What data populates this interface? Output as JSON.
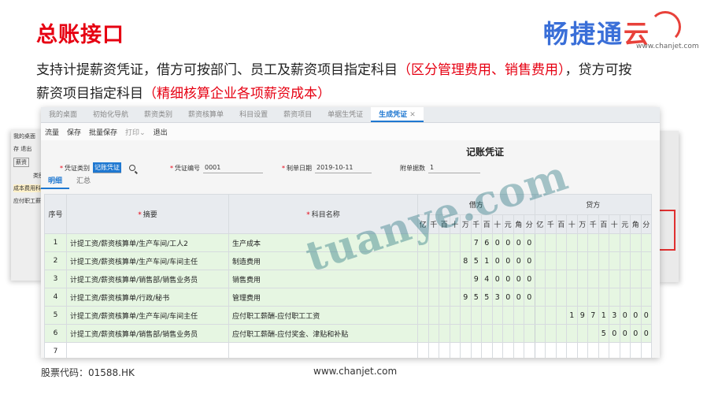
{
  "title": "总账接口",
  "logo": {
    "text_main": "畅捷通",
    "text_suffix": "云",
    "url": "www.chanjet.com",
    "colors": {
      "blue": "#3a6fd8",
      "red": "#e8413a"
    }
  },
  "description": {
    "line1_a": "支持计提薪资凭证，借方可按部门、员工及薪资项目指定科目",
    "line1_red": "（区分管理费用、销售费用）",
    "line1_b": "，贷方可按",
    "line2_a": "薪资项目指定科目",
    "line2_red": "（精细核算企业各项薪资成本）"
  },
  "app": {
    "tabs": [
      "我的桌面",
      "初始化导航",
      "薪资类别",
      "薪资核算单",
      "科目设置",
      "薪资项目",
      "单据生凭证",
      "生成凭证"
    ],
    "active_tab": "生成凭证",
    "close_icon": "✕",
    "toolbar": {
      "flow": "流量",
      "save": "保存",
      "batch_save": "批量保存",
      "print": "打印",
      "print_caret": "⌄",
      "exit": "退出"
    },
    "voucher_title": "记账凭证",
    "form": {
      "category_label": "凭证类别",
      "category_value": "记账凭证",
      "number_label": "凭证编号",
      "number_value": "0001",
      "date_label": "制单日期",
      "date_value": "2019-10-11",
      "attach_label": "附单据数",
      "attach_value": "1",
      "required_mark": "*"
    },
    "subtabs": [
      "明细",
      "汇总"
    ],
    "grid": {
      "col_seq": "序号",
      "col_summary": "摘要",
      "col_account": "科目名称",
      "debit": "借方",
      "credit": "贷方",
      "units": [
        "亿",
        "千",
        "百",
        "十",
        "万",
        "千",
        "百",
        "十",
        "元",
        "角",
        "分"
      ],
      "rows": [
        {
          "seq": "1",
          "summary": "计提工资/薪资核算单/生产车间/工人2",
          "account": "生产成本",
          "debit": [
            "",
            "",
            "",
            "",
            "",
            "",
            "7",
            "6",
            "0",
            "0",
            "0",
            "0"
          ],
          "credit": [
            "",
            "",
            "",
            "",
            "",
            "",
            "",
            "",
            "",
            "",
            ""
          ]
        },
        {
          "seq": "2",
          "summary": "计提工资/薪资核算单/生产车间/车间主任",
          "account": "制造费用",
          "debit": [
            "",
            "",
            "",
            "",
            "",
            "8",
            "5",
            "1",
            "0",
            "0",
            "0",
            "0"
          ],
          "credit": [
            "",
            "",
            "",
            "",
            "",
            "",
            "",
            "",
            "",
            "",
            ""
          ]
        },
        {
          "seq": "3",
          "summary": "计提工资/薪资核算单/销售部/销售业务员",
          "account": "销售费用",
          "debit": [
            "",
            "",
            "",
            "",
            "",
            "",
            "9",
            "4",
            "0",
            "0",
            "0",
            "0"
          ],
          "credit": [
            "",
            "",
            "",
            "",
            "",
            "",
            "",
            "",
            "",
            "",
            ""
          ]
        },
        {
          "seq": "4",
          "summary": "计提工资/薪资核算单/行政/秘书",
          "account": "管理费用",
          "debit": [
            "",
            "",
            "",
            "",
            "",
            "9",
            "5",
            "5",
            "3",
            "0",
            "0",
            "0"
          ],
          "credit": [
            "",
            "",
            "",
            "",
            "",
            "",
            "",
            "",
            "",
            "",
            ""
          ]
        },
        {
          "seq": "5",
          "summary": "计提工资/薪资核算单/生产车间/车间主任",
          "account": "应付职工薪酬-应付职工工资",
          "debit": [
            "",
            "",
            "",
            "",
            "",
            "",
            "",
            "",
            "",
            "",
            "",
            ""
          ],
          "credit": [
            "",
            "",
            "",
            "1",
            "9",
            "7",
            "1",
            "3",
            "0",
            "0",
            "0"
          ]
        },
        {
          "seq": "6",
          "summary": "计提工资/薪资核算单/销售部/销售业务员",
          "account": "应付职工薪酬-应付奖金、津贴和补贴",
          "debit": [
            "",
            "",
            "",
            "",
            "",
            "",
            "",
            "",
            "",
            "",
            "",
            ""
          ],
          "credit": [
            "",
            "",
            "",
            "",
            "",
            "",
            "5",
            "0",
            "0",
            "0",
            "0"
          ]
        },
        {
          "seq": "7",
          "summary": "",
          "account": "",
          "debit": [
            "",
            "",
            "",
            "",
            "",
            "",
            "",
            "",
            "",
            "",
            "",
            ""
          ],
          "credit": [
            "",
            "",
            "",
            "",
            "",
            "",
            "",
            "",
            "",
            "",
            ""
          ]
        }
      ]
    },
    "background_left": {
      "label1": "我的桌面",
      "label2": "存 退出",
      "label3": "薪资",
      "label4": "类别",
      "label5": "成本费用科",
      "label6": "应付职工薪"
    }
  },
  "watermark": "tuanye.com",
  "footer": {
    "stock_code": "股票代码：01588.HK",
    "website": "www.chanjet.com"
  }
}
